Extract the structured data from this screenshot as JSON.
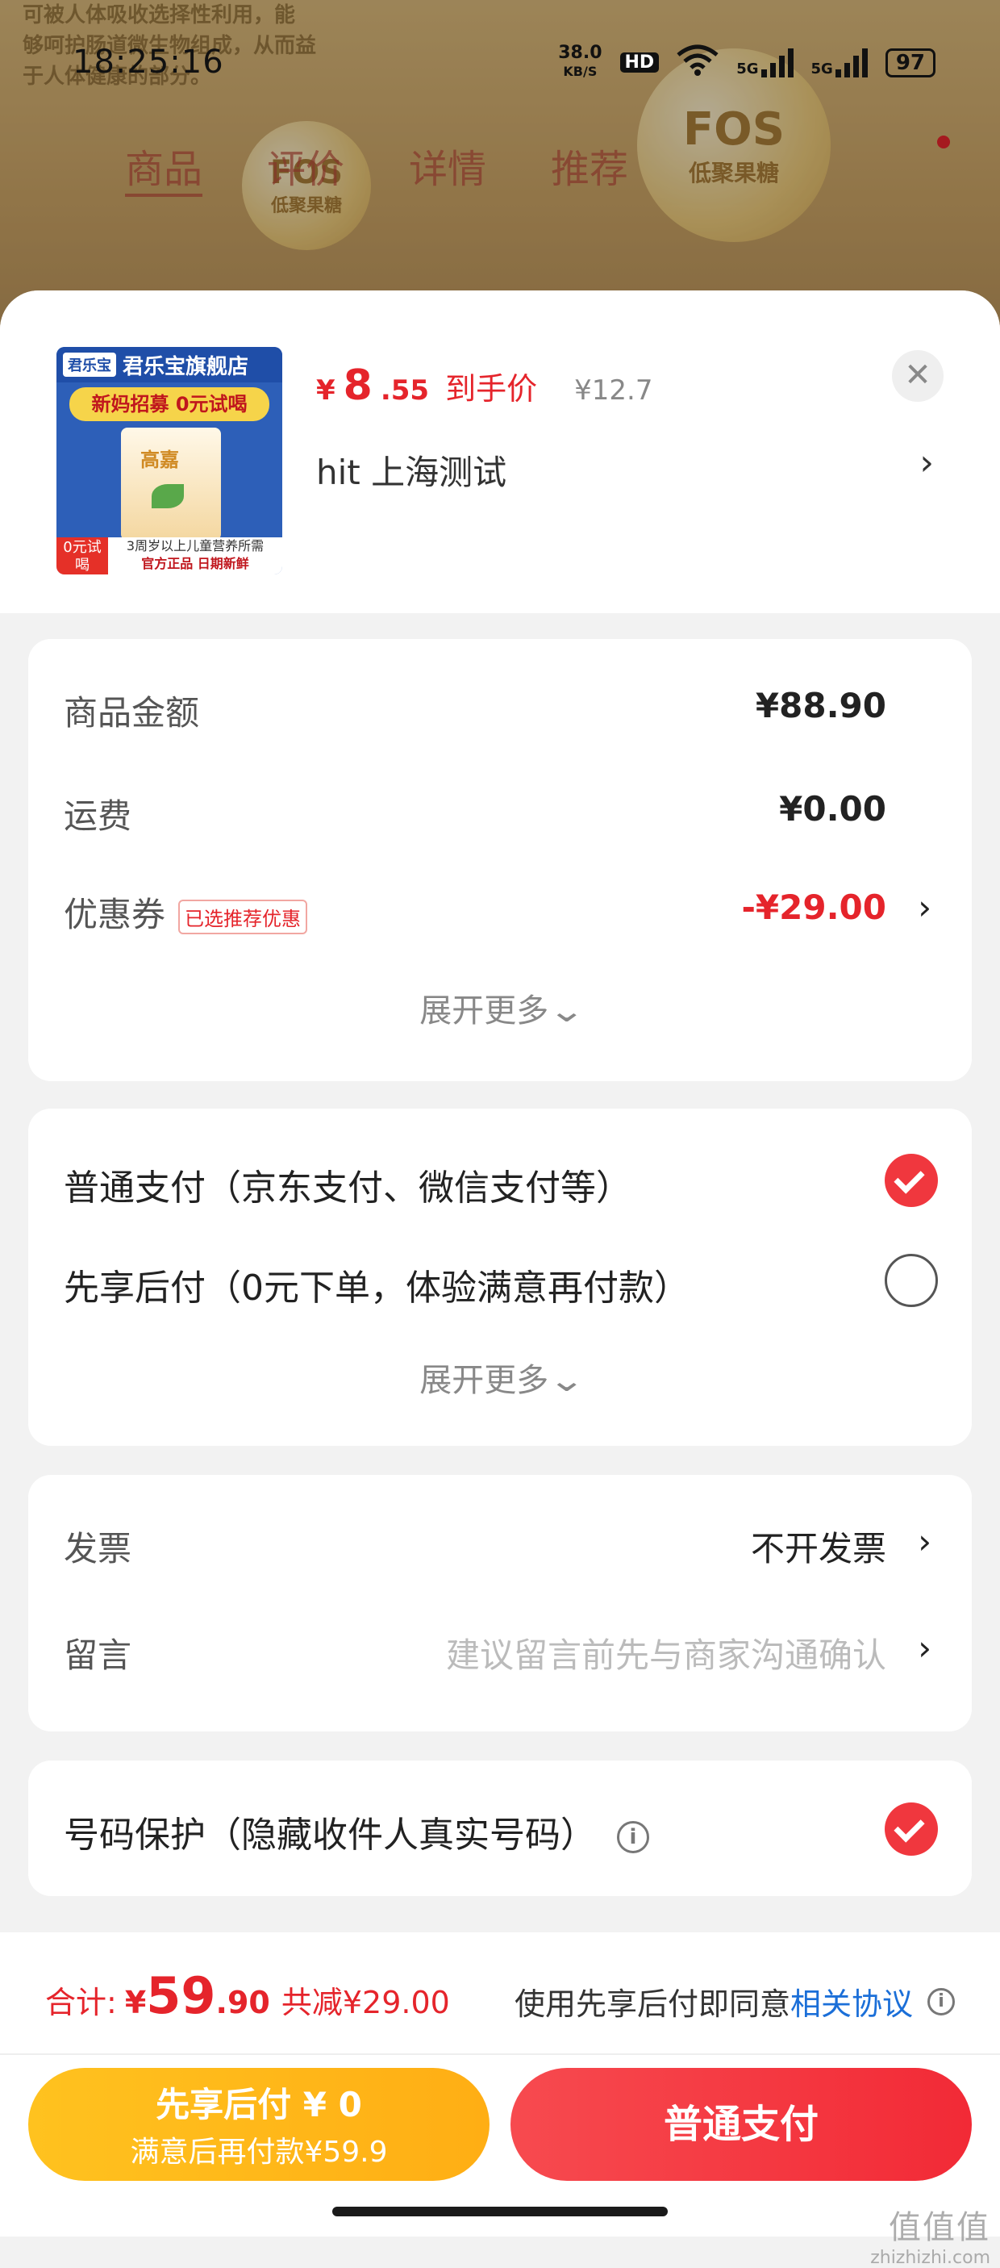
{
  "status_bar": {
    "time": "18:25:16",
    "net_speed_value": "38.0",
    "net_speed_unit": "KB/S",
    "hd_label": "HD",
    "sim1_label": "5G",
    "sim2_label": "5G",
    "battery": "97"
  },
  "background_page": {
    "blurb_line1": "可被人体吸收选择性利用，能",
    "blurb_line2": "够呵护肠道微生物组成，从而益",
    "blurb_line3": "于人体健康的部分。",
    "badge_fos": "FOS",
    "badge_sub": "低聚果糖",
    "tabs": [
      "商品",
      "评价",
      "详情",
      "推荐"
    ]
  },
  "product": {
    "image_store_name": "君乐宝旗舰店",
    "image_logo": "君乐宝",
    "image_banner": "新妈招募 0元试喝",
    "image_box_text": "高嘉",
    "image_zero_badge": "0元试喝",
    "image_bottom_line1": "3周岁以上儿童营养所需",
    "image_bottom_line2": "官方正品 日期新鲜",
    "price_symbol": "¥",
    "price_int": "8",
    "price_dec": ".55",
    "price_label": "到手价",
    "original_price": "¥12.7",
    "address": "hit  上海测试"
  },
  "amount_card": {
    "goods_label": "商品金额",
    "goods_value": "¥88.90",
    "shipping_label": "运费",
    "shipping_value": "¥0.00",
    "coupon_label": "优惠券",
    "coupon_badge": "已选推荐优惠",
    "coupon_value": "-¥29.00",
    "expand_label": "展开更多"
  },
  "payment_card": {
    "option_normal": "普通支付（京东支付、微信支付等）",
    "option_later": "先享后付（0元下单，体验满意再付款）",
    "expand_label": "展开更多"
  },
  "invoice_card": {
    "invoice_label": "发票",
    "invoice_value": "不开发票",
    "message_label": "留言",
    "message_placeholder": "建议留言前先与商家沟通确认"
  },
  "privacy_card": {
    "label": "号码保护（隐藏收件人真实号码）"
  },
  "bottom": {
    "total_label": "合计:",
    "total_symbol": "¥",
    "total_int": "59",
    "total_dec": ".90",
    "total_saved": "共减¥29.00",
    "agree_text": "使用先享后付即同意",
    "agree_link": "相关协议",
    "btn_later_main": "先享后付 ¥ 0",
    "btn_later_sub": "满意后再付款¥59.9",
    "btn_normal": "普通支付"
  },
  "watermark": {
    "line1": "值值值",
    "line2": "zhizhizhi.com"
  },
  "colors": {
    "accent_red": "#e5242b",
    "link_blue": "#1b6fd8",
    "button_yellow": "#ffb81a",
    "button_red": "#f2333c"
  }
}
